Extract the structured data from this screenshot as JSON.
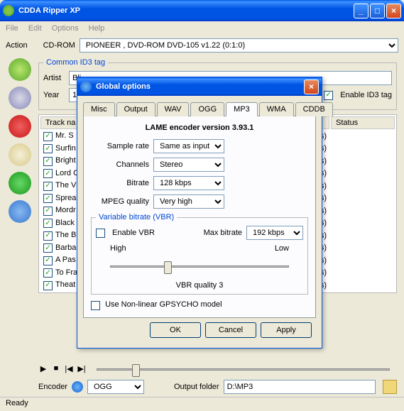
{
  "window": {
    "title": "CDDA Ripper XP",
    "menu": [
      "File",
      "Edit",
      "Options",
      "Help"
    ]
  },
  "action_label": "Action",
  "cdrom_label": "CD-ROM",
  "cdrom_value": "PIONEER , DVD-ROM DVD-105  v1.22 (0:1:0)",
  "id3": {
    "legend": "Common ID3 tag",
    "artist_label": "Artist",
    "artist_value": "Bli",
    "year_label": "Year",
    "year_value": "19",
    "enable_label": "Enable ID3 tag"
  },
  "tracklist": {
    "cols": [
      "Track na",
      "",
      "",
      "Status"
    ],
    "rows": [
      "Mr. S",
      "Surfin",
      "Bright",
      "Lord C",
      "The V",
      "Sprea",
      "Mordr",
      "Black",
      "The B",
      "Barba",
      "A Pas",
      "To Fra",
      "Theat"
    ],
    "right_text": "bps)"
  },
  "dialog": {
    "title": "Global options",
    "tabs": [
      "Misc",
      "Output",
      "WAV",
      "OGG",
      "MP3",
      "WMA",
      "CDDB"
    ],
    "active_tab": "MP3",
    "header": "LAME encoder version 3.93.1",
    "sample_rate_label": "Sample rate",
    "sample_rate_value": "Same as input",
    "channels_label": "Channels",
    "channels_value": "Stereo",
    "bitrate_label": "Bitrate",
    "bitrate_value": "128 kbps",
    "quality_label": "MPEG quality",
    "quality_value": "Very high",
    "vbr_legend": "Variable bitrate (VBR)",
    "enable_vbr_label": "Enable VBR",
    "max_bitrate_label": "Max bitrate",
    "max_bitrate_value": "192 kbps",
    "slider_high": "High",
    "slider_low": "Low",
    "slider_caption": "VBR quality 3",
    "gpsycho_label": "Use Non-linear GPSYCHO model",
    "ok": "OK",
    "cancel": "Cancel",
    "apply": "Apply"
  },
  "bottom": {
    "encoder_label": "Encoder",
    "encoder_value": "OGG",
    "output_label": "Output folder",
    "output_value": "D:\\MP3"
  },
  "status": "Ready"
}
